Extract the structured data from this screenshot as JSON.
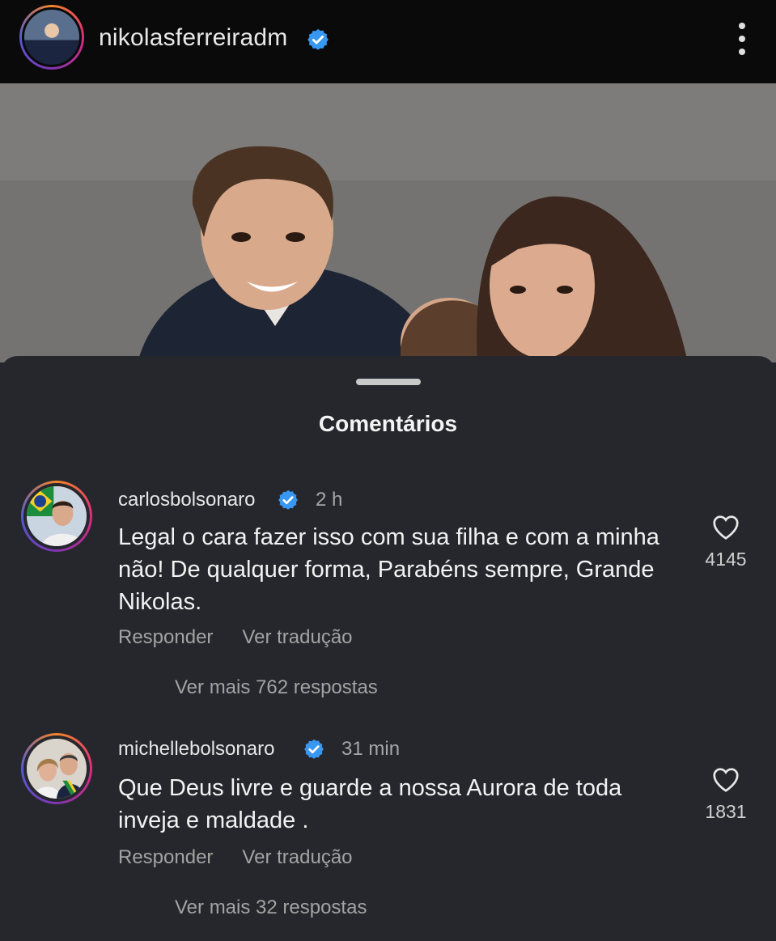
{
  "header": {
    "username": "nikolasferreiradm",
    "avatar": "profile-avatar",
    "verified_icon": "verified-badge-icon",
    "menu_icon": "more-vertical-icon"
  },
  "post": {
    "image": "post-photo"
  },
  "comments_sheet": {
    "title": "Comentários",
    "comments": [
      {
        "username": "carlosbolsonaro",
        "time": "2 h",
        "text": "Legal o cara fazer isso com sua filha e com a minha não! De qualquer forma, Parabéns sempre, Grande Nikolas.",
        "reply_label": "Responder",
        "translate_label": "Ver tradução",
        "more_replies": "Ver mais 762 respostas",
        "likes": "4145"
      },
      {
        "username": "michellebolsonaro",
        "time": "31 min",
        "text": "Que Deus livre e guarde a  nossa Aurora de toda inveja e maldade .",
        "reply_label": "Responder",
        "translate_label": "Ver tradução",
        "more_replies": "Ver mais 32 respostas",
        "likes": "1831"
      }
    ]
  },
  "colors": {
    "sheet_bg": "#25272c",
    "header_bg": "#0a0a0a",
    "verified_blue": "#3897f0",
    "muted_text": "#a3a3a3"
  }
}
